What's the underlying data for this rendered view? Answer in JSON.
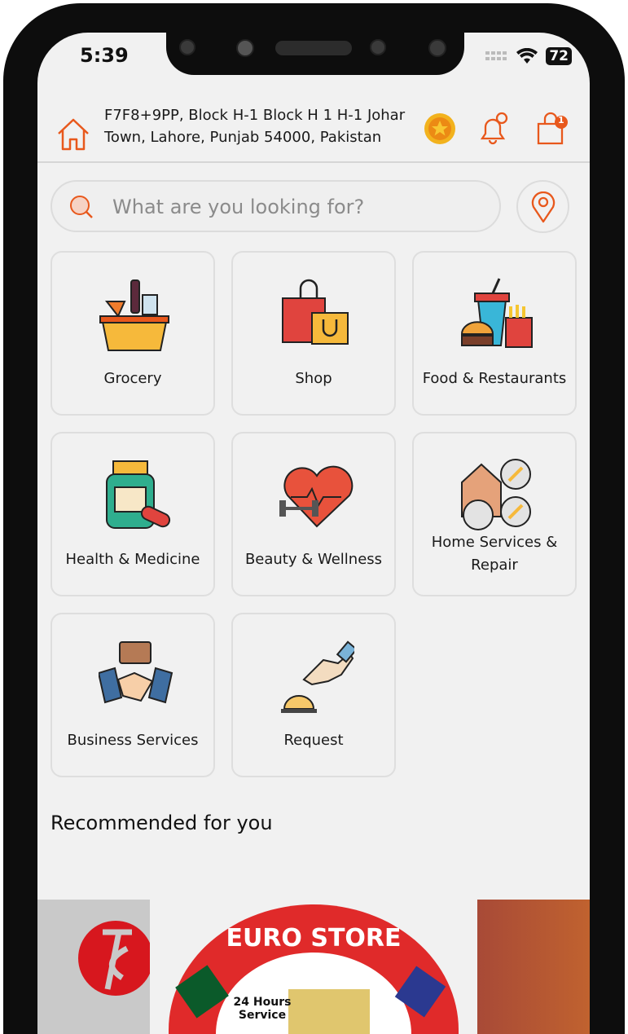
{
  "status": {
    "time": "5:39",
    "battery": "72"
  },
  "header": {
    "address": "F7F8+9PP, Block H-1 Block H 1 H-1 Johar Town, Lahore, Punjab 54000, Pakistan",
    "cart_badge": "1"
  },
  "search": {
    "placeholder": "What are you looking for?"
  },
  "categories": [
    {
      "label": "Grocery"
    },
    {
      "label": "Shop"
    },
    {
      "label": "Food & Restaurants"
    },
    {
      "label": "Health & Medicine"
    },
    {
      "label": "Beauty & Wellness"
    },
    {
      "label": "Home Services & Repair"
    },
    {
      "label": "Business Services"
    },
    {
      "label": "Request"
    }
  ],
  "recommended": {
    "title": "Recommended for you",
    "banners": [
      {
        "name": "JS logo"
      },
      {
        "title": "EURO STORE",
        "subtitle": "24 Hours Service"
      },
      {
        "name": "orange banner"
      }
    ]
  },
  "colors": {
    "accent": "#e8581c",
    "background": "#f1f1f1"
  }
}
